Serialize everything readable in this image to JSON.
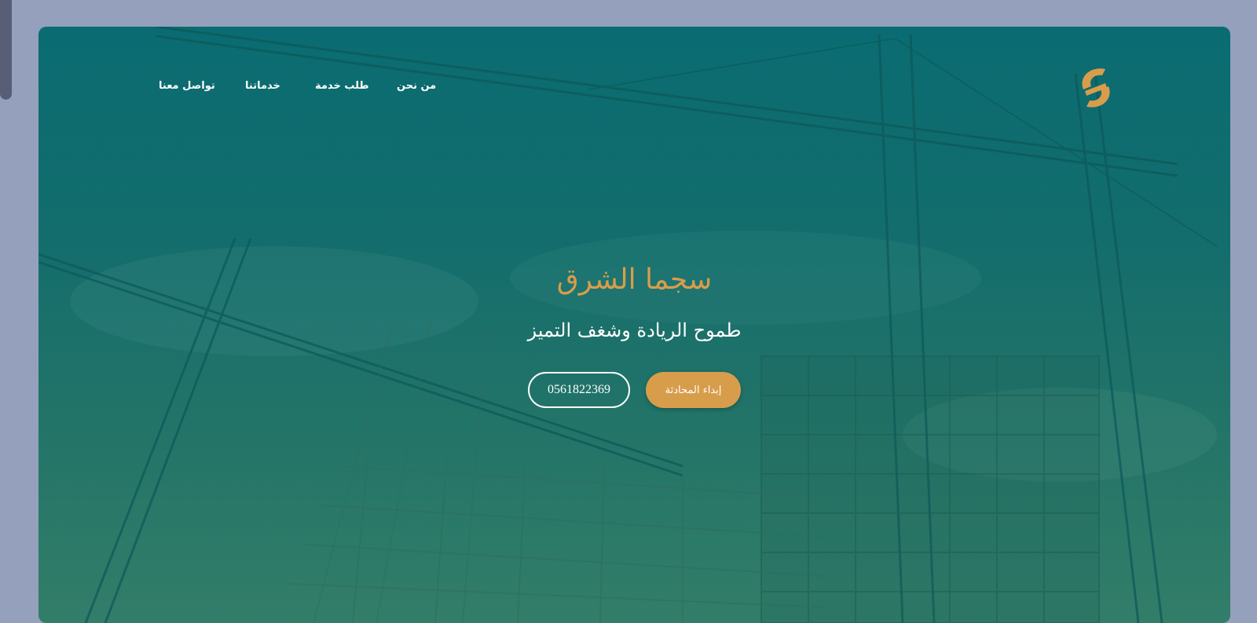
{
  "brand": {
    "logo_icon": "sajma-logo-icon",
    "accent_color": "#d89d4b"
  },
  "nav": {
    "items": [
      {
        "label": "من نحن"
      },
      {
        "label": "طلب خدمة"
      },
      {
        "label": "خدماتنا"
      },
      {
        "label": "تواصل معنا"
      }
    ]
  },
  "hero": {
    "title": "سجما الشرق",
    "subtitle": "طموح الريادة وشغف التميز",
    "primary_button": "إبداء المحادثة",
    "phone_button": "0561822369"
  },
  "colors": {
    "overlay_teal": "#0a6d72",
    "page_background": "#94a0bc",
    "white": "#ffffff"
  }
}
